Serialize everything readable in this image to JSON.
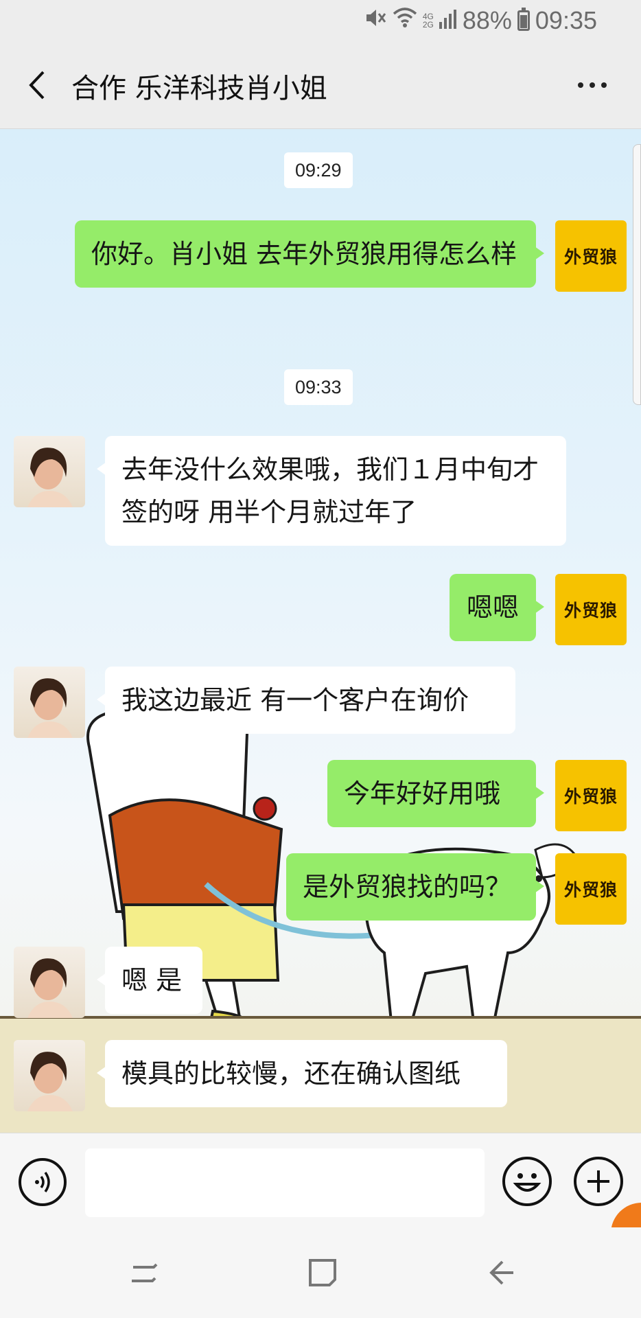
{
  "status_bar": {
    "network_top": "4G",
    "network_bottom": "2G",
    "battery": "88%",
    "time": "09:35",
    "icons": [
      "mute-icon",
      "wifi-icon",
      "signal-icon",
      "battery-icon"
    ]
  },
  "header": {
    "title": "合作 乐洋科技肖小姐",
    "back_icon": "chevron-left-icon",
    "more_icon": "more-dots-icon"
  },
  "my_avatar_text": "外贸狼",
  "chat": {
    "timestamps": [
      "09:29",
      "09:33"
    ],
    "messages": [
      {
        "sender": "me",
        "text": "你好。肖小姐 去年外贸狼用得怎么样"
      },
      {
        "sender": "her",
        "text": "去年没什么效果哦，我们１月中旬才签的呀  用半个月就过年了"
      },
      {
        "sender": "me",
        "text": "嗯嗯"
      },
      {
        "sender": "her",
        "text": "我这边最近 有一个客户在询价"
      },
      {
        "sender": "me",
        "text": "今年好好用哦"
      },
      {
        "sender": "me",
        "text": "是外贸狼找的吗？"
      },
      {
        "sender": "her",
        "text": "嗯 是"
      },
      {
        "sender": "her",
        "text": "模具的比较慢，还在确认图纸"
      }
    ]
  },
  "input_bar": {
    "placeholder": "",
    "voice_icon": "voice-icon",
    "emoji_icon": "emoji-icon",
    "plus_icon": "plus-icon"
  },
  "colors": {
    "my_bubble": "#95ec69",
    "her_bubble": "#ffffff",
    "avatar_brand": "#f6c200"
  }
}
